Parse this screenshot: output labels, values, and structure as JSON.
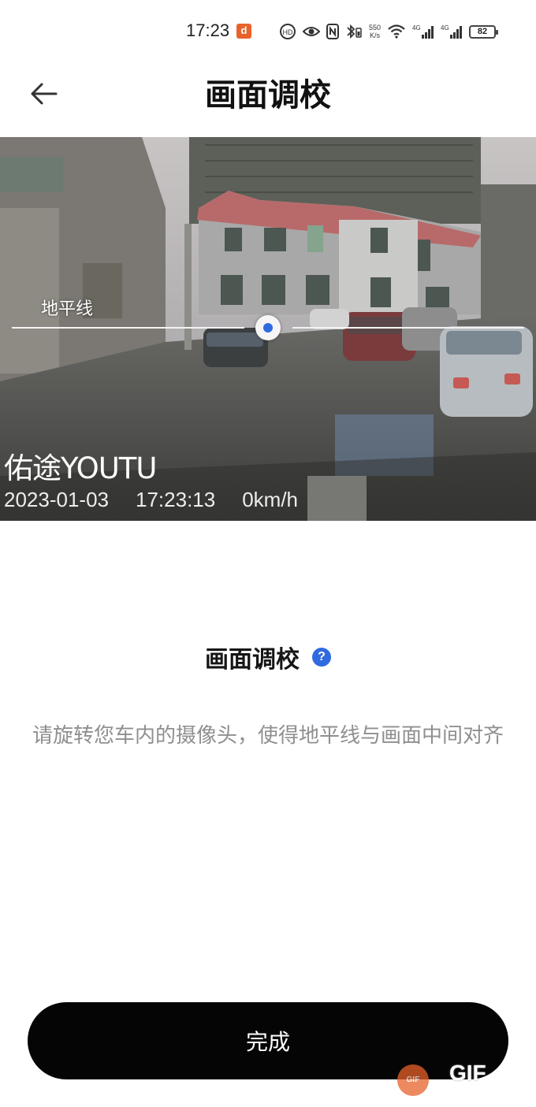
{
  "status_bar": {
    "time": "17:23",
    "notification_badge": "d",
    "net_speed_value": "550",
    "net_speed_unit": "K/s",
    "signal_1_label": "4G",
    "signal_2_label": "4G",
    "battery_level": "82",
    "icons": [
      "hd-voice-icon",
      "eye-icon",
      "nfc-icon",
      "bluetooth-battery-icon",
      "wifi-icon",
      "cell-signal-icon",
      "cell-signal-icon",
      "battery-icon"
    ]
  },
  "header": {
    "back_icon": "arrow-left-icon",
    "title": "画面调校"
  },
  "camera": {
    "horizon_label": "地平线",
    "watermark_brand": "佑途YOUTU",
    "watermark_date": "2023-01-03",
    "watermark_time": "17:23:13",
    "watermark_speed": "0km/h"
  },
  "calibration": {
    "title": "画面调校",
    "help_icon": "?",
    "instruction": "请旋转您车内的摄像头，使得地平线与画面中间对齐"
  },
  "actions": {
    "done_label": "完成"
  },
  "overlay": {
    "gif_badge": "GIF",
    "gif_text": "GIF"
  },
  "colors": {
    "accent_blue": "#2f6ae0",
    "button_black": "#050505",
    "badge_orange": "#e8622a",
    "instruction_gray": "#8f8f8f"
  }
}
